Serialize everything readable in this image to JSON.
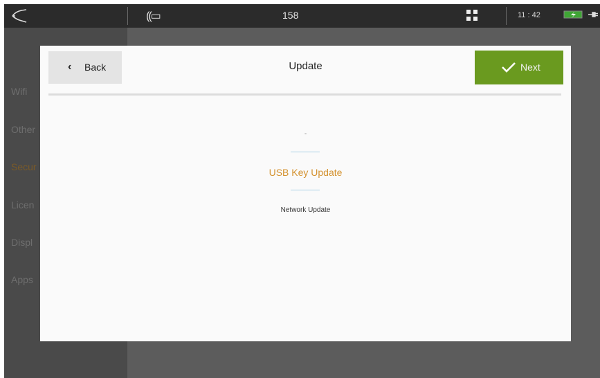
{
  "topbar": {
    "logo_icon": "fish-logo-icon",
    "signal_text": "((▭",
    "center_number": "158",
    "grid_icon": "grid-icon",
    "clock": "11 : 42",
    "battery_icon": "battery-charging-icon",
    "battery_color": "#3fa535"
  },
  "sidebar": {
    "items": [
      {
        "label": "Wifi"
      },
      {
        "label": "Other"
      },
      {
        "label": "Secur"
      },
      {
        "label": "Licen"
      },
      {
        "label": "Displ"
      },
      {
        "label": "Apps"
      }
    ]
  },
  "modal": {
    "title": "Update",
    "back_label": "Back",
    "back_icon": "chevron-left-icon",
    "next_label": "Next",
    "next_icon": "check-icon",
    "next_color": "#6a9a1f",
    "options": {
      "placeholder": "-",
      "selected": "USB Key Update",
      "other": "Network Update"
    },
    "selected_color": "#d4922f"
  }
}
